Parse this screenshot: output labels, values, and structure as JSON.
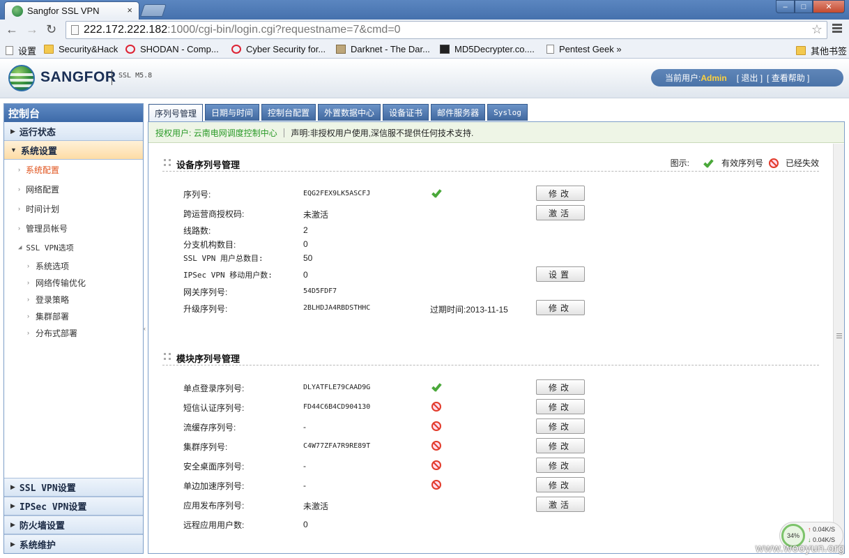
{
  "browser": {
    "tab_title": "Sangfor SSL VPN",
    "tab_close": "×",
    "url_host": "222.172.222.182",
    "url_rest": ":1000/cgi-bin/login.cgi?requestname=7&cmd=0",
    "bookmarks": [
      {
        "label": "设置",
        "icon": "page-icon"
      },
      {
        "label": "Security&Hack",
        "icon": "folder-icon"
      },
      {
        "label": "SHODAN - Comp...",
        "icon": "shodan-icon"
      },
      {
        "label": "Cyber Security for...",
        "icon": "redcircle-icon"
      },
      {
        "label": "Darknet - The Dar...",
        "icon": "darknet-icon"
      },
      {
        "label": "MD5Decrypter.co....",
        "icon": "md5-icon"
      },
      {
        "label": "Pentest Geek »",
        "icon": "page-icon"
      },
      {
        "label": "其他书签",
        "icon": "folder-icon"
      }
    ]
  },
  "header": {
    "logo": "SANGFOR",
    "version": "SSL M5.8",
    "current_user_label": "当前用户:",
    "current_user": "Admin",
    "logout": "[ 退出 ]",
    "help": "[ 查看帮助 ]"
  },
  "sidebar": {
    "title": "控制台",
    "sections_top": [
      {
        "label": "运行状态",
        "open": false
      },
      {
        "label": "系统设置",
        "open": true
      }
    ],
    "items": [
      {
        "label": "系统配置",
        "active": true
      },
      {
        "label": "网络配置"
      },
      {
        "label": "时间计划"
      },
      {
        "label": "管理员帐号"
      }
    ],
    "group": "SSL VPN选项",
    "group_items": [
      "系统选项",
      "网络传输优化",
      "登录策略",
      "集群部署",
      "分布式部署"
    ],
    "sections_bottom": [
      "SSL VPN设置",
      "IPSec VPN设置",
      "防火墙设置",
      "系统维护"
    ]
  },
  "tabs": [
    "序列号管理",
    "日期与时间",
    "控制台配置",
    "外置数据中心",
    "设备证书",
    "邮件服务器",
    "Syslog"
  ],
  "notice": {
    "auth_label": "授权用户:",
    "auth_value": "云南电网调度控制中心",
    "statement": "声明:非授权用户使用,深信服不提供任何技术支持."
  },
  "device_section": {
    "title": "设备序列号管理",
    "legend_label": "图示:",
    "legend_valid": "有效序列号",
    "legend_invalid": "已经失效",
    "rows": [
      {
        "label": "序列号:",
        "value": "EQG2FEX9LK5ASCFJ",
        "status": "valid",
        "button": "修改"
      },
      {
        "label": "跨运营商授权码:",
        "value": "未激活",
        "button": "激活"
      },
      {
        "label": "线路数:",
        "value": "2"
      },
      {
        "label": "分支机构数目:",
        "value": "0"
      },
      {
        "label": "SSL VPN 用户总数目:",
        "value": "50"
      },
      {
        "label": "IPSec VPN 移动用户数:",
        "value": "0",
        "button": "设置"
      },
      {
        "label": "网关序列号:",
        "value": "54D5FDF7"
      },
      {
        "label": "升级序列号:",
        "value": "2BLHDJA4RBDSTHHC",
        "extra": "过期时间:2013-11-15",
        "button": "修改"
      }
    ]
  },
  "module_section": {
    "title": "模块序列号管理",
    "rows": [
      {
        "label": "单点登录序列号:",
        "value": "DLYATFLE79CAAD9G",
        "status": "valid",
        "button": "修改"
      },
      {
        "label": "短信认证序列号:",
        "value": "FD44C6B4CD904130",
        "status": "invalid",
        "button": "修改"
      },
      {
        "label": "流缓存序列号:",
        "value": "-",
        "status": "invalid",
        "button": "修改"
      },
      {
        "label": "集群序列号:",
        "value": "C4W77ZFA7R9RE89T",
        "status": "invalid",
        "button": "修改"
      },
      {
        "label": "安全桌面序列号:",
        "value": "-",
        "status": "invalid",
        "button": "修改"
      },
      {
        "label": "单边加速序列号:",
        "value": "-",
        "status": "invalid",
        "button": "修改"
      },
      {
        "label": "应用发布序列号:",
        "value": "未激活",
        "button": "激活"
      },
      {
        "label": "远程应用用户数:",
        "value": "0"
      }
    ]
  },
  "net_widget": {
    "percent": "34%",
    "up": "0.04K/S",
    "down": "0.04K/S"
  },
  "watermark": "www.wooyun.org",
  "colors": {
    "accent": "#4571ad",
    "valid": "#4aa83a",
    "invalid": "#e23a2a",
    "active_item": "#e0521b",
    "user": "#ffd23d"
  }
}
